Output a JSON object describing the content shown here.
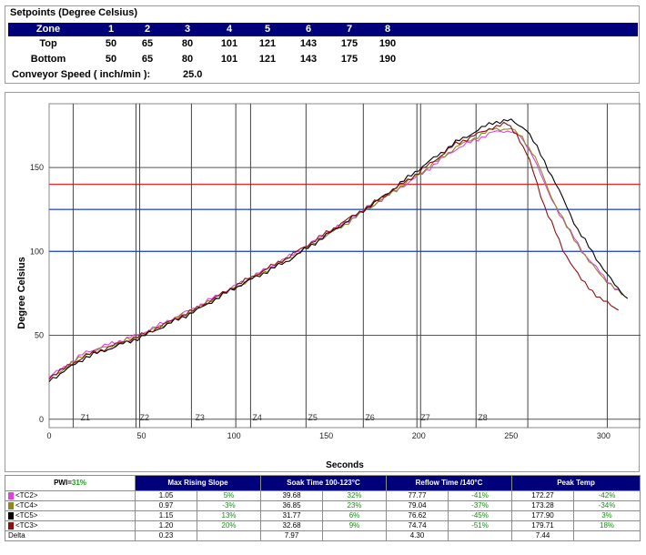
{
  "setpoints": {
    "title": "Setpoints (Degree Celsius)",
    "zone_label": "Zone",
    "zones": [
      "1",
      "2",
      "3",
      "4",
      "5",
      "6",
      "7",
      "8"
    ],
    "rows": [
      {
        "label": "Top",
        "values": [
          "50",
          "65",
          "80",
          "101",
          "121",
          "143",
          "175",
          "190"
        ]
      },
      {
        "label": "Bottom",
        "values": [
          "50",
          "65",
          "80",
          "101",
          "121",
          "143",
          "175",
          "190"
        ]
      }
    ],
    "conveyor_label": "Conveyor Speed ( inch/min ):",
    "conveyor_value": "25.0"
  },
  "chart_data": {
    "type": "line",
    "xlabel": "Seconds",
    "ylabel": "Degree Celsius",
    "xlim": [
      0,
      320
    ],
    "ylim": [
      -5,
      188
    ],
    "x_ticks": [
      0,
      50,
      100,
      150,
      200,
      250,
      300
    ],
    "y_ticks": [
      0,
      50,
      100,
      150
    ],
    "grid": true,
    "zone_markers": [
      {
        "label": "Z1",
        "x": 16
      },
      {
        "label": "Z2",
        "x": 48
      },
      {
        "label": "Z3",
        "x": 78
      },
      {
        "label": "Z4",
        "x": 109
      },
      {
        "label": "Z5",
        "x": 139
      },
      {
        "label": "Z6",
        "x": 170
      },
      {
        "label": "Z7",
        "x": 200
      },
      {
        "label": "Z8",
        "x": 231
      }
    ],
    "extra_vertical_lines": [
      13,
      47,
      49,
      77,
      101,
      109,
      139,
      170,
      199,
      201,
      231,
      259,
      302
    ],
    "reference_lines": [
      {
        "y": 140,
        "color": "#e03030"
      },
      {
        "y": 125,
        "color": "#3050e0"
      },
      {
        "y": 100,
        "color": "#3050e0"
      }
    ],
    "series": [
      {
        "name": "<TC2>",
        "color": "#e040e0",
        "x": [
          0,
          20,
          50,
          80,
          100,
          130,
          160,
          180,
          200,
          220,
          240,
          250,
          255,
          262,
          270,
          280,
          290,
          300,
          310
        ],
        "y": [
          25,
          40,
          51,
          67,
          79,
          97,
          117,
          131,
          145,
          161,
          171,
          172,
          168,
          157,
          135,
          115,
          98,
          85,
          74
        ]
      },
      {
        "name": "<TC4>",
        "color": "#8a8a20",
        "x": [
          0,
          20,
          50,
          80,
          100,
          130,
          160,
          180,
          200,
          220,
          240,
          250,
          256,
          263,
          272,
          282,
          292,
          302,
          310
        ],
        "y": [
          24,
          39,
          50,
          66,
          78,
          96,
          116,
          131,
          146,
          162,
          173,
          173,
          168,
          156,
          132,
          111,
          94,
          82,
          74
        ]
      },
      {
        "name": "<TC5>",
        "color": "#000000",
        "x": [
          0,
          20,
          50,
          80,
          100,
          130,
          160,
          180,
          200,
          220,
          240,
          250,
          258,
          266,
          276,
          286,
          296,
          306,
          313
        ],
        "y": [
          23,
          37,
          49,
          65,
          78,
          95,
          117,
          132,
          149,
          165,
          177,
          178,
          173,
          158,
          136,
          113,
          96,
          80,
          72
        ]
      },
      {
        "name": "<TC3>",
        "color": "#8a1010",
        "x": [
          0,
          20,
          50,
          80,
          100,
          130,
          160,
          180,
          200,
          220,
          240,
          248,
          253,
          260,
          268,
          278,
          288,
          298,
          308
        ],
        "y": [
          25,
          38,
          50,
          66,
          79,
          97,
          118,
          132,
          147,
          164,
          174,
          176,
          170,
          154,
          127,
          101,
          83,
          72,
          65
        ]
      }
    ]
  },
  "stats": {
    "pwi_label": "PWI=",
    "pwi_value": "31%",
    "headers": [
      "Max Rising Slope",
      "Soak Time 100-123°C",
      "Reflow Time /140°C",
      "Peak Temp"
    ],
    "rows": [
      {
        "label": "<TC2>",
        "color": "#e040e0",
        "cells": [
          "1.05",
          "5%",
          "39.68",
          "32%",
          "77.77",
          "-41%",
          "172.27",
          "-42%"
        ]
      },
      {
        "label": "<TC4>",
        "color": "#8a8a20",
        "cells": [
          "0.97",
          "-3%",
          "36.85",
          "23%",
          "79.04",
          "-37%",
          "173.28",
          "-34%"
        ]
      },
      {
        "label": "<TC5>",
        "color": "#000000",
        "cells": [
          "1.15",
          "13%",
          "31.77",
          "6%",
          "76.62",
          "-45%",
          "177.90",
          "3%"
        ]
      },
      {
        "label": "<TC3>",
        "color": "#8a1010",
        "cells": [
          "1.20",
          "20%",
          "32.68",
          "9%",
          "74.74",
          "-51%",
          "179.71",
          "18%"
        ]
      },
      {
        "label": "Delta",
        "color": "",
        "cells": [
          "0.23",
          "",
          "7.97",
          "",
          "4.30",
          "",
          "7.44",
          ""
        ]
      }
    ]
  }
}
